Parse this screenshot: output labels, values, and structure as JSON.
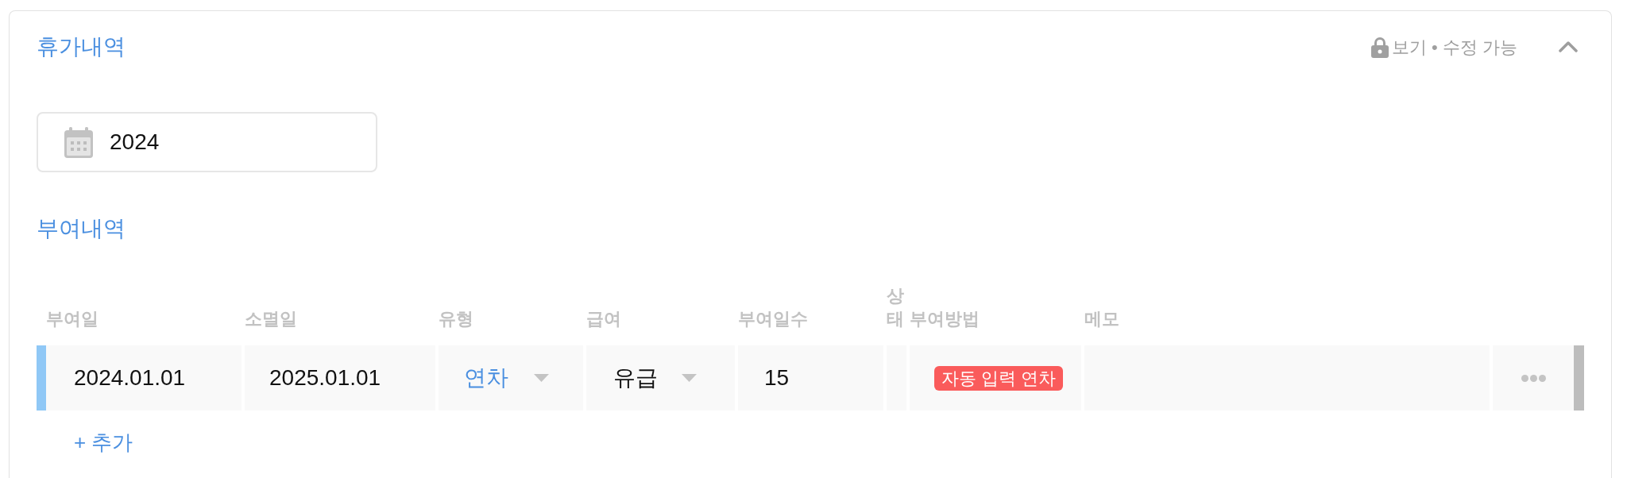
{
  "section": {
    "title": "휴가내역",
    "permission": "보기 • 수정 가능",
    "expanded": true
  },
  "year_field": {
    "value": "2024"
  },
  "grants": {
    "title": "부여내역",
    "columns": [
      "부여일",
      "소멸일",
      "유형",
      "급여",
      "부여일수",
      "상태",
      "부여방법",
      "메모"
    ],
    "rows": [
      {
        "grant_date": "2024.01.01",
        "expiry_date": "2025.01.01",
        "type": "연차",
        "pay": "유급",
        "days": "15",
        "method": "자동 입력 연차"
      }
    ],
    "add_label": "+ 추가"
  }
}
